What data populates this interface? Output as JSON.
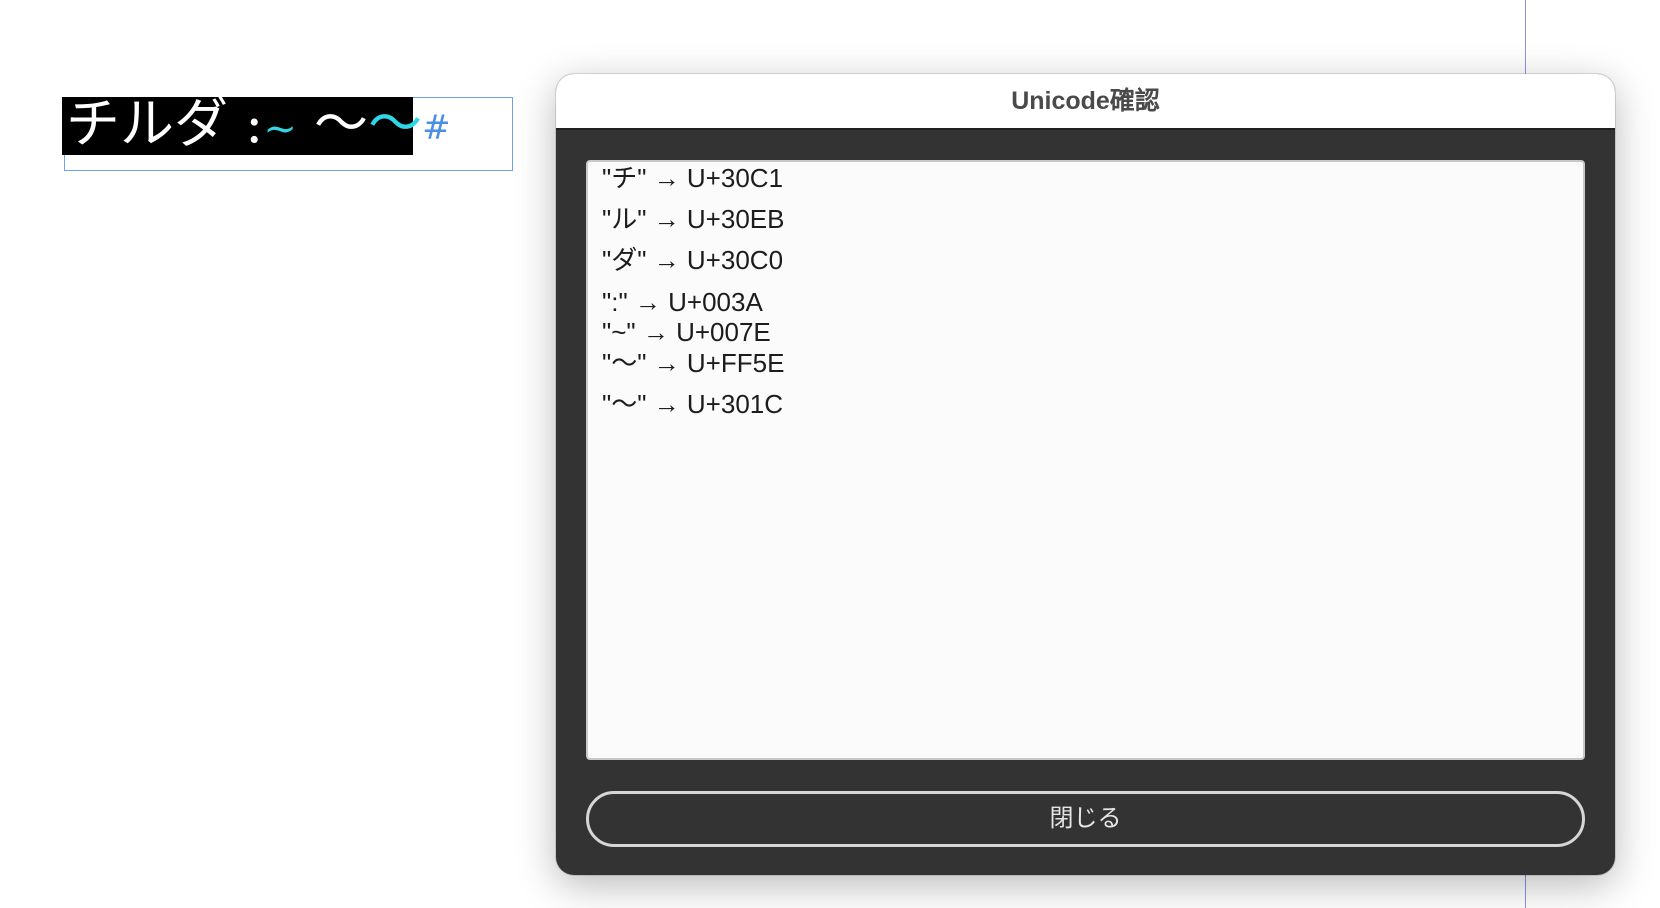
{
  "canvas": {
    "text_frame": {
      "segments": [
        {
          "text": "チルダ ",
          "style": "normal"
        },
        {
          "text": ":",
          "style": "normal"
        },
        {
          "text": "~",
          "style": "cyan-small"
        },
        {
          "text": " ～",
          "style": "normal"
        },
        {
          "text": "〜",
          "style": "cyan"
        },
        {
          "text": "#",
          "style": "hash"
        }
      ]
    }
  },
  "dialog": {
    "title": "Unicode確認",
    "entries": [
      "\"チ\" → U+30C1",
      "\"ル\" → U+30EB",
      "\"ダ\" → U+30C0",
      "\":\" → U+003A",
      "\"~\" → U+007E",
      "\"～\" → U+FF5E",
      "\"〜\" → U+301C"
    ],
    "close_label": "閉じる"
  },
  "colors": {
    "dialog_body": "#333333",
    "list_background": "#fbfbfb",
    "selection": "#000000",
    "glyph_highlight": "#2fd6e6",
    "frame_border": "#6aa3e8",
    "guide_line": "#8c92f2"
  }
}
